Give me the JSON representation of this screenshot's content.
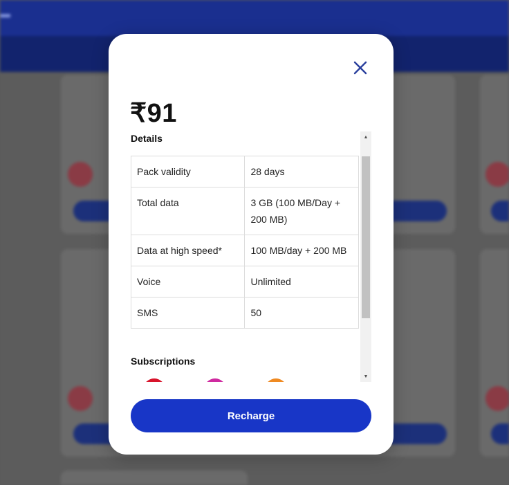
{
  "modal": {
    "price": "₹91",
    "details_heading": "Details",
    "rows": [
      {
        "label": "Pack validity",
        "value": "28 days"
      },
      {
        "label": "Total data",
        "value": "3 GB (100 MB/Day + 200 MB)"
      },
      {
        "label": "Data at high speed*",
        "value": "100 MB/day + 200 MB"
      },
      {
        "label": "Voice",
        "value": "Unlimited"
      },
      {
        "label": "SMS",
        "value": "50"
      }
    ],
    "subscriptions_heading": "Subscriptions",
    "recharge_label": "Recharge",
    "close_icon": "close-icon"
  },
  "colors": {
    "accent": "#1836c7",
    "close_icon": "#2a3f9d",
    "overlay": "#5b5b5b",
    "nav_bg": "#1a2f8f"
  }
}
